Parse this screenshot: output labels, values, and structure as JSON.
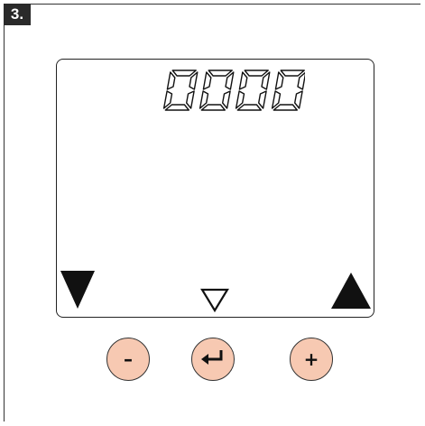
{
  "step": {
    "label": "3."
  },
  "display": {
    "readout": "0000",
    "left_indicator": "filled-down-triangle-icon",
    "center_indicator": "outline-down-triangle-icon",
    "right_indicator": "filled-up-triangle-icon"
  },
  "buttons": {
    "minus_label": "–",
    "enter_icon": "enter-arrow-icon",
    "plus_label": "+",
    "fill_color": "#f7c9b2"
  }
}
